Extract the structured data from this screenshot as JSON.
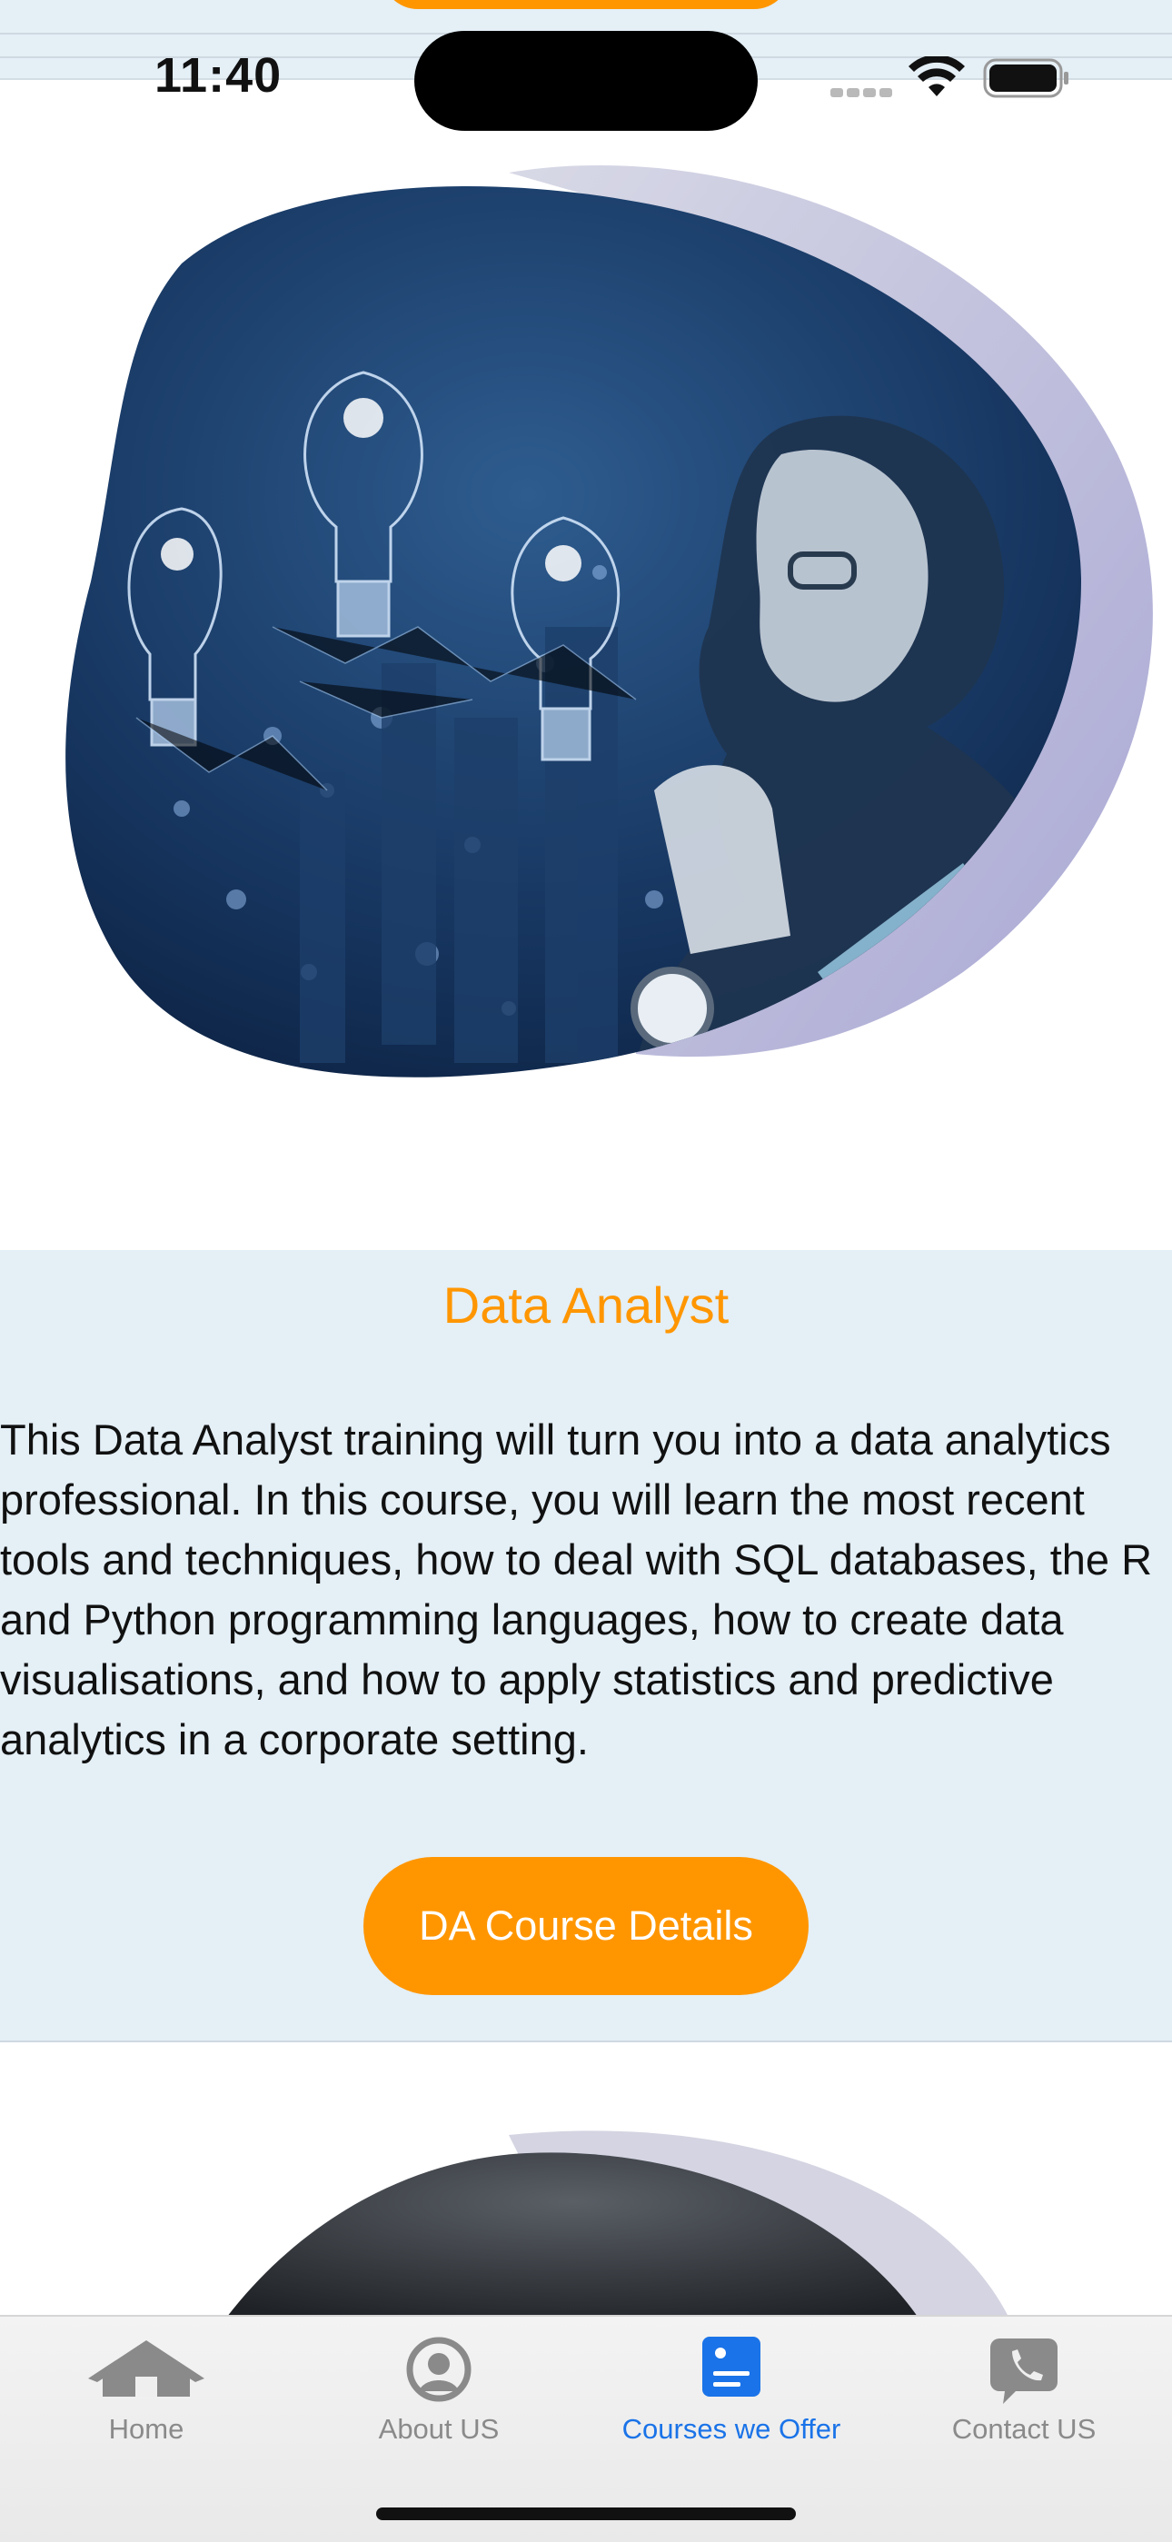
{
  "status_bar": {
    "time": "11:40"
  },
  "hero": {
    "image_alt": "Woman with glasses thinking beside glowing light bulbs over a night city"
  },
  "course": {
    "title": "Data Analyst",
    "description": "This Data Analyst training will turn you into a data analytics professional. In this course, you will learn the most recent tools and techniques, how to deal with SQL databases, the R and Python programming languages, how to create data visualisations, and how to apply statistics and predictive analytics in a corporate setting.",
    "button_label": "DA Course Details"
  },
  "tabs": [
    {
      "label": "Home",
      "icon": "house-icon",
      "active": false
    },
    {
      "label": "About US",
      "icon": "person-circle-icon",
      "active": false
    },
    {
      "label": "Courses we Offer",
      "icon": "course-list-icon",
      "active": true
    },
    {
      "label": "Contact US",
      "icon": "phone-bubble-icon",
      "active": false
    }
  ],
  "colors": {
    "accent": "#ff9600",
    "card_bg": "#e4eff6",
    "tab_active": "#1a73e8",
    "tab_inactive": "#8a8a8a"
  }
}
